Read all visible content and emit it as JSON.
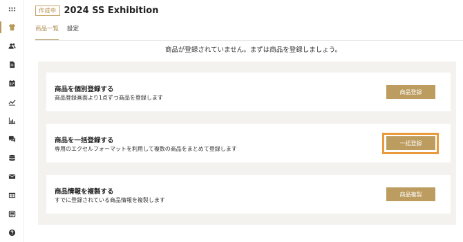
{
  "header": {
    "status_badge": "作成中",
    "title": "2024 SS Exhibition"
  },
  "tabs": [
    {
      "label": "商品一覧",
      "active": true
    },
    {
      "label": "設定",
      "active": false
    }
  ],
  "empty_message": "商品が登録されていません。まずは商品を登録しましょう。",
  "cards": [
    {
      "title": "商品を個別登録する",
      "description": "商品登録画面より1点ずつ商品を登録します",
      "button_label": "商品登録"
    },
    {
      "title": "商品を一括登録する",
      "description": "専用のエクセルフォーマットを利用して複数の商品をまとめて登録します",
      "button_label": "一括登録"
    },
    {
      "title": "商品情報を複製する",
      "description": "すでに登録されている商品情報を複製します",
      "button_label": "商品複製"
    }
  ],
  "sidebar": {
    "items": [
      {
        "icon": "apps-grid-icon",
        "active": false
      },
      {
        "icon": "tshirt-icon",
        "active": true
      },
      {
        "icon": "users-icon",
        "active": false
      },
      {
        "icon": "document-icon",
        "active": false
      },
      {
        "icon": "calendar-icon",
        "active": false
      },
      {
        "icon": "trend-chart-icon",
        "active": false
      },
      {
        "icon": "bar-chart-icon",
        "active": false
      },
      {
        "icon": "chat-icon",
        "active": false
      },
      {
        "icon": "database-icon",
        "active": false
      },
      {
        "icon": "mail-icon",
        "active": false
      },
      {
        "icon": "table-icon",
        "active": false
      },
      {
        "icon": "newspaper-icon",
        "active": false
      },
      {
        "icon": "help-icon",
        "active": false
      }
    ]
  },
  "colors": {
    "accent": "#bc9c5f",
    "focus_ring": "#eb9a3b",
    "panel_bg": "#f3f2ef"
  }
}
